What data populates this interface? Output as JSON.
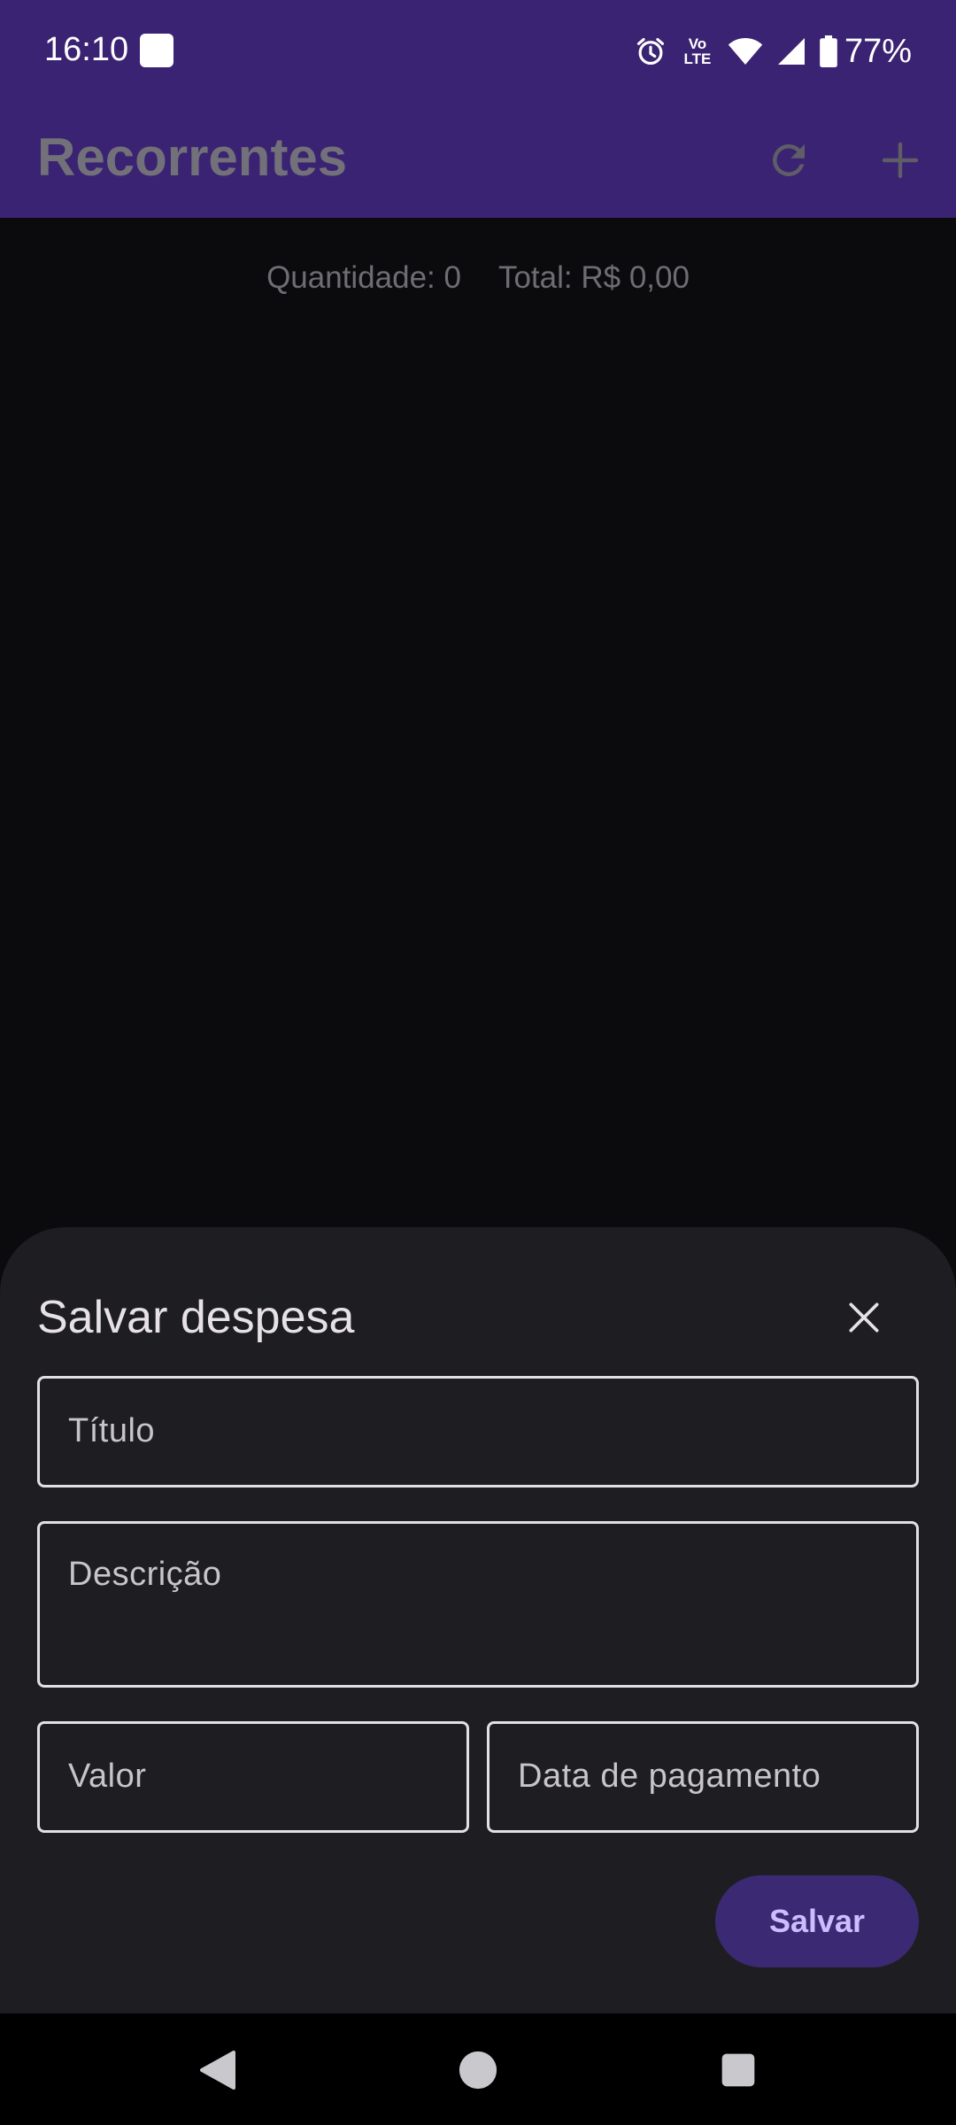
{
  "status_bar": {
    "time": "16:10",
    "network_label_top": "Vo",
    "network_label_bottom": "LTE",
    "battery": "77%"
  },
  "app_bar": {
    "title": "Recorrentes",
    "refresh_icon": "refresh-icon",
    "add_icon": "plus-icon",
    "background": "#3b2373"
  },
  "summary": {
    "quantity": "Quantidade: 0",
    "total": "Total: R$ 0,00"
  },
  "sheet": {
    "title": "Salvar despesa",
    "close_icon": "close-icon",
    "fields": {
      "title_placeholder": "Título",
      "description_placeholder": "Descrição",
      "value_placeholder": "Valor",
      "date_placeholder": "Data de pagamento"
    },
    "save_label": "Salvar",
    "save_color": "#3b2a73"
  },
  "nav_bar": {
    "back_icon": "back-triangle-icon",
    "home_icon": "home-circle-icon",
    "recent_icon": "recent-square-icon"
  }
}
